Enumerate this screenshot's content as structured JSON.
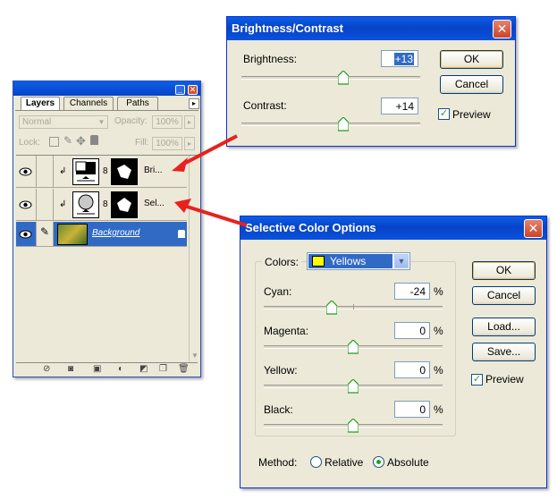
{
  "brightness_dialog": {
    "title": "Brightness/Contrast",
    "close_label": "✕",
    "brightness_label": "Brightness:",
    "brightness_value": "+13",
    "brightness_level": 0.57,
    "contrast_label": "Contrast:",
    "contrast_value": "+14",
    "contrast_level": 0.57,
    "ok_label": "OK",
    "cancel_label": "Cancel",
    "preview_label": "Preview",
    "preview_checked": true
  },
  "layers_panel": {
    "minimize_label": "_",
    "close_label": "✕",
    "menu_label": "▸",
    "tabs": [
      {
        "label": "Layers",
        "active": true
      },
      {
        "label": "Channels",
        "active": false
      },
      {
        "label": "Paths",
        "active": false
      }
    ],
    "blend_mode": "Normal",
    "opacity_label": "Opacity:",
    "opacity_value": "100%",
    "lock_label": "Lock:",
    "fill_label": "Fill:",
    "fill_value": "100%",
    "layers": [
      {
        "name": "Bri...",
        "type": "adjustment-brightness",
        "selected": false
      },
      {
        "name": "Sel...",
        "type": "adjustment-selective-color",
        "selected": false
      },
      {
        "name": "Background",
        "type": "background",
        "selected": true
      }
    ],
    "footer_icons": [
      "link-layers-icon",
      "layer-style-icon",
      "layer-mask-icon",
      "new-group-icon",
      "new-adjustment-layer-icon",
      "new-layer-icon",
      "trash-icon"
    ]
  },
  "selective_dialog": {
    "title": "Selective Color Options",
    "close_label": "✕",
    "colors_label": "Colors:",
    "colors_value": "Yellows",
    "swatch_color": "#ffff00",
    "sliders": [
      {
        "label": "Cyan:",
        "value": "-24",
        "unit": "%",
        "level": 0.38
      },
      {
        "label": "Magenta:",
        "value": "0",
        "unit": "%",
        "level": 0.5
      },
      {
        "label": "Yellow:",
        "value": "0",
        "unit": "%",
        "level": 0.5
      },
      {
        "label": "Black:",
        "value": "0",
        "unit": "%",
        "level": 0.5
      }
    ],
    "ok_label": "OK",
    "cancel_label": "Cancel",
    "load_label": "Load...",
    "save_label": "Save...",
    "preview_label": "Preview",
    "preview_checked": true,
    "method_label": "Method:",
    "method_options": [
      {
        "label": "Relative",
        "selected": false
      },
      {
        "label": "Absolute",
        "selected": true
      }
    ]
  },
  "colors": {
    "title_blue": "#0a52dc",
    "selection_blue": "#316ac5",
    "annotation_red": "#e8211f"
  }
}
